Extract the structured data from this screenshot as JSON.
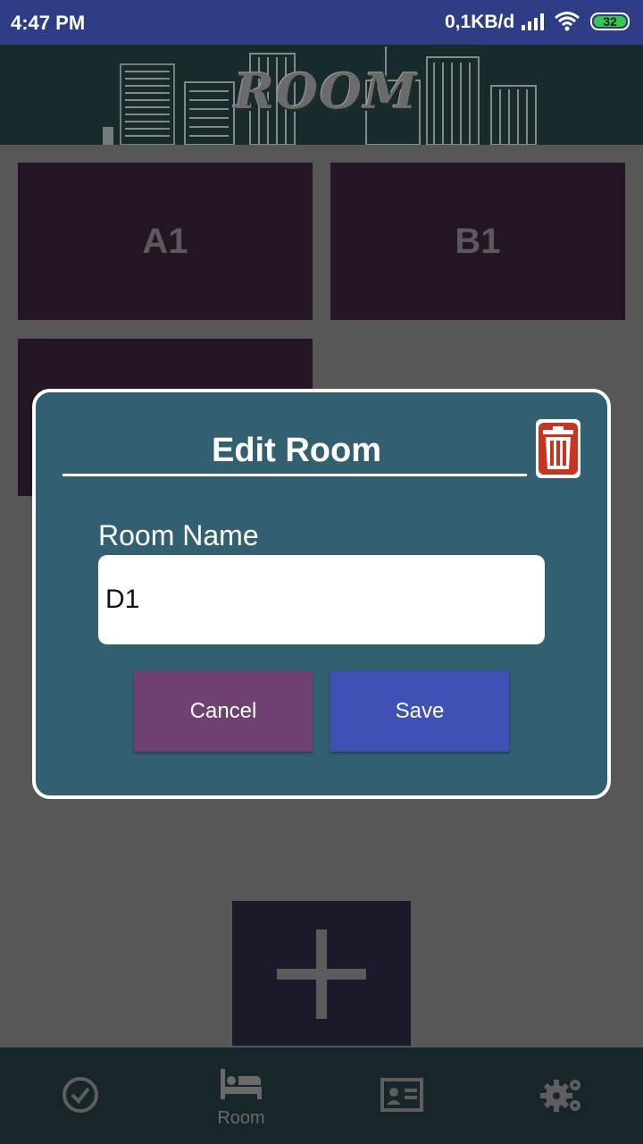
{
  "status_bar": {
    "time": "4:47 PM",
    "network_speed": "0,1KB/d",
    "battery_level": "32",
    "icons": [
      "signal-icon",
      "wifi-icon",
      "battery-icon"
    ]
  },
  "header": {
    "title": "ROOM"
  },
  "rooms": [
    {
      "name": "A1"
    },
    {
      "name": "B1"
    },
    {
      "name": ""
    }
  ],
  "add_button": {
    "icon": "plus-icon"
  },
  "dialog": {
    "title": "Edit Room",
    "delete_icon": "trash-icon",
    "field_label": "Room Name",
    "field_value": "D1",
    "cancel_label": "Cancel",
    "save_label": "Save"
  },
  "bottom_nav": {
    "items": [
      {
        "icon": "check-circle-icon",
        "label": ""
      },
      {
        "icon": "bed-icon",
        "label": "Room"
      },
      {
        "icon": "id-card-icon",
        "label": ""
      },
      {
        "icon": "gears-icon",
        "label": ""
      }
    ],
    "active_index": 1
  },
  "colors": {
    "status_bar": "#2f3d86",
    "dialog_bg": "#326070",
    "cancel": "#6f4170",
    "save": "#3f51b5",
    "tile": "#231523",
    "trash": "#c8341f"
  }
}
